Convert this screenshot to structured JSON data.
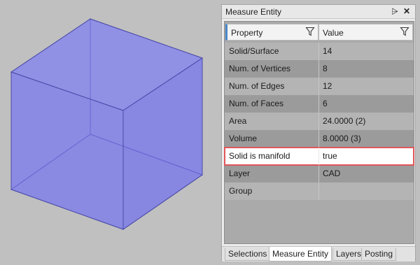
{
  "panel": {
    "title": "Measure Entity",
    "pin_glyph": "⩥",
    "close_glyph": "✕"
  },
  "grid": {
    "headers": {
      "property": "Property",
      "value": "Value"
    },
    "rows": [
      {
        "property": "Solid/Surface",
        "value": "14"
      },
      {
        "property": "Num. of Vertices",
        "value": "8"
      },
      {
        "property": "Num. of Edges",
        "value": "12"
      },
      {
        "property": "Num. of Faces",
        "value": "6"
      },
      {
        "property": "Area",
        "value": "24.0000 (2)"
      },
      {
        "property": "Volume",
        "value": "8.0000 (3)"
      },
      {
        "property": "Solid is manifold",
        "value": "true"
      },
      {
        "property": "Layer",
        "value": "CAD"
      },
      {
        "property": "Group",
        "value": ""
      }
    ],
    "highlight_color": "#e0565b"
  },
  "tabs": [
    {
      "label": "Selections",
      "active": false
    },
    {
      "label": "Measure Entity",
      "active": true
    },
    {
      "label": "Layers",
      "active": false
    },
    {
      "label": "Posting",
      "active": false
    }
  ],
  "colors": {
    "cube_face": "#8080f0",
    "cube_edge": "#4a4aa8",
    "viewport_bg": "#c0c0c0"
  }
}
